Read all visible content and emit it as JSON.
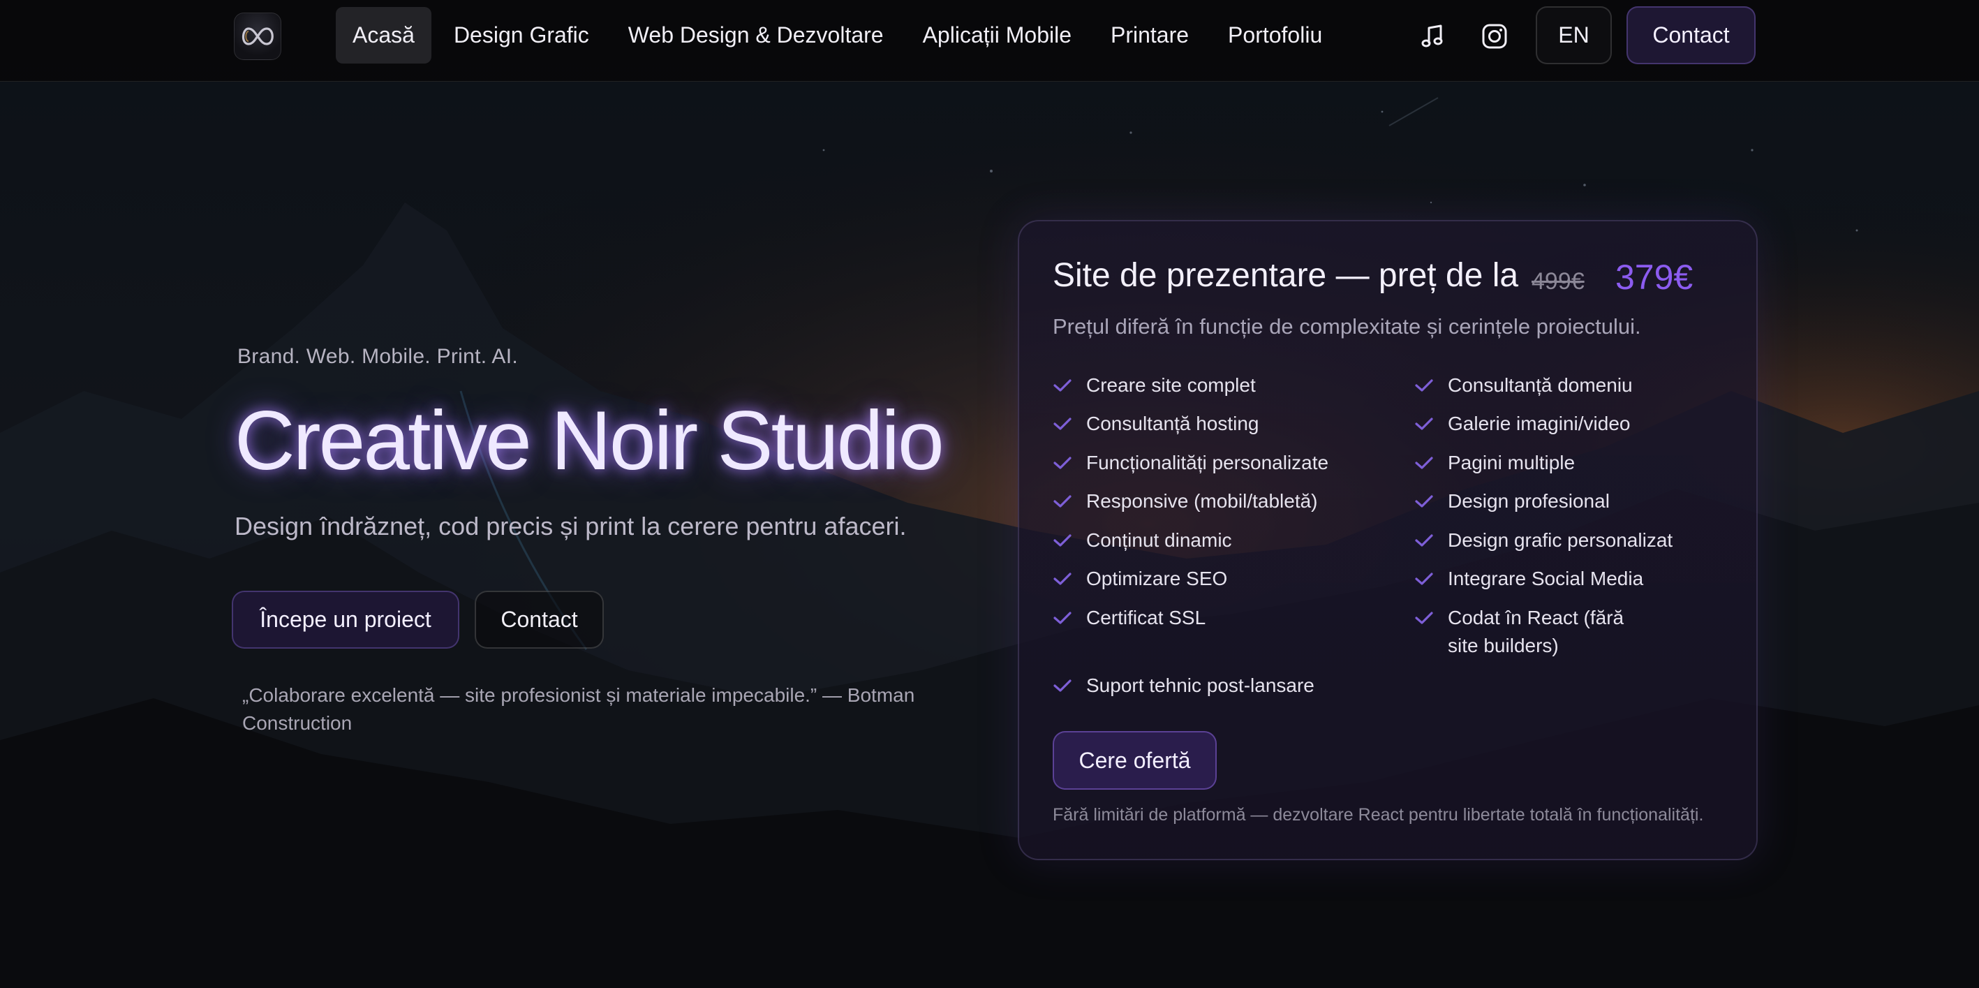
{
  "nav": {
    "logo_alt": "Creative Noir Studio logo",
    "items": [
      {
        "label": "Acasă",
        "active": true
      },
      {
        "label": "Design Grafic",
        "active": false
      },
      {
        "label": "Web Design & Dezvoltare",
        "active": false
      },
      {
        "label": "Aplicații Mobile",
        "active": false
      },
      {
        "label": "Printare",
        "active": false
      },
      {
        "label": "Portofoliu",
        "active": false
      }
    ],
    "icons": [
      "music-note-icon",
      "instagram-icon"
    ],
    "lang": "EN",
    "contact": "Contact"
  },
  "hero": {
    "tagline": "Brand. Web. Mobile. Print. AI.",
    "title": "Creative Noir Studio",
    "subtitle": "Design îndrăzneț, cod precis și print la cerere pentru afaceri.",
    "primary_button": "Începe un proiect",
    "secondary_button": "Contact",
    "testimonial": "„Colaborare excelentă — site profesionist și materiale impecabile.” — Botman Construction"
  },
  "pricing": {
    "title": "Site de prezentare — preț de la",
    "old_price": "499€",
    "new_price": "379€",
    "subtitle": "Prețul diferă în funcție de complexitate și cerințele proiectului.",
    "features_left": [
      "Creare site complet",
      "Consultanță hosting",
      "Funcționalități personalizate",
      "Responsive (mobil/tabletă)",
      "Conținut dinamic",
      "Optimizare SEO",
      "Certificat SSL",
      "Suport tehnic post-lansare"
    ],
    "features_right": [
      "Consultanță domeniu",
      "Galerie imagini/video",
      "Pagini multiple",
      "Design profesional",
      "Design grafic personalizat",
      "Integrare Social Media",
      "Codat în React (fără site builders)"
    ],
    "cta": "Cere ofertă",
    "footnote": "Fără limitări de platformă — dezvoltare React pentru libertate totală în funcționalități."
  },
  "colors": {
    "accent": "#8c5cf0",
    "check": "#7e5fd8",
    "background": "#07070a"
  }
}
